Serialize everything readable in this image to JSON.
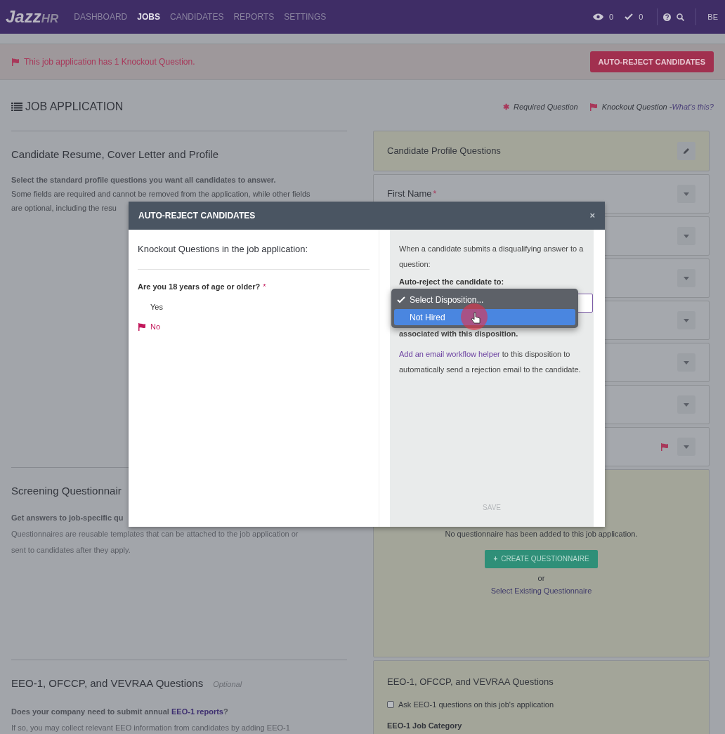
{
  "nav": {
    "logo": [
      "Jazz",
      "HR"
    ],
    "menu": [
      {
        "label": "DASHBOARD",
        "selected": false
      },
      {
        "label": "JOBS",
        "selected": true
      },
      {
        "label": "CANDIDATES",
        "selected": false
      },
      {
        "label": "REPORTS",
        "selected": false
      },
      {
        "label": "SETTINGS",
        "selected": false
      }
    ],
    "views_count": "0",
    "checks_count": "0",
    "user": "BE"
  },
  "banner": {
    "message": "This job application has 1 Knockout Question.",
    "button": "AUTO-REJECT CANDIDATES"
  },
  "header": {
    "title": "JOB APPLICATION",
    "required_icon": "✱",
    "required_legend": "Required Question",
    "knockout_legend": "Knockout Question",
    "separator": " - ",
    "help_link": "What's this?"
  },
  "left_sections": [
    {
      "title": "Candidate Resume, Cover Letter and Profile",
      "lead": "Select the standard profile questions you want all candidates to answer.",
      "lines": [
        "Some fields are required and cannot be removed from the application, while other fields",
        "are optional, including the resu"
      ]
    },
    {
      "title": "Screening Questionnair",
      "lead": "Get answers to job-specific qu",
      "lines": [
        "Questionnaires are reusable templates that can be attached to the job application or",
        "sent to candidates after they apply."
      ]
    },
    {
      "title": "EEO-1, OFCCP, and VEVRAA Questions",
      "tag": "Optional",
      "question_prefix": "Does your company need to submit annual ",
      "question_link": "EEO-1 reports",
      "question_suffix": "?",
      "lines": [
        "If so, you may collect relevant EEO information from candidates by adding EEO-1"
      ]
    }
  ],
  "profile_card": {
    "title": "Candidate Profile Questions",
    "required_mark": "*",
    "rows": [
      {
        "label": "First Name",
        "required": true,
        "knockout": false
      },
      {
        "knockout": false
      },
      {
        "knockout": false
      },
      {
        "knockout": false
      },
      {
        "knockout": false
      },
      {
        "knockout": false
      },
      {
        "knockout": true
      }
    ]
  },
  "screening_card": {
    "message": "No questionnaire has been added to this job application.",
    "button": "CREATE QUESTIONNAIRE",
    "button_icon": "+",
    "or": "or",
    "link": "Select Existing Questionnaire"
  },
  "eeo_card": {
    "title": "EEO-1, OFCCP, and VEVRAA Questions",
    "checkbox": {
      "label": "Ask EEO-1 questions on this job's application",
      "checked": false
    },
    "field_label": "EEO-1 Job Category"
  },
  "modal": {
    "title": "AUTO-REJECT CANDIDATES",
    "close": "×",
    "required_mark": "*",
    "heading": "Knockout Questions in the job application:",
    "question": {
      "text": "Are you 18 years of age or older?",
      "required": true,
      "answers": [
        {
          "label": "Yes",
          "knockout": false
        },
        {
          "label": "No",
          "knockout": true
        }
      ]
    },
    "intro": "When a candidate submits a disqualifying answer to a question:",
    "field_label": "Auto-reject the candidate to:",
    "options": [
      {
        "label": "Select Disposition...",
        "checked": true,
        "highlighted": false
      },
      {
        "label": "Not Hired",
        "checked": false,
        "highlighted": true
      }
    ],
    "note": "associated with this disposition.",
    "link": "Add an email workflow helper",
    "link_rest": " to this disposition to automatically send a rejection email to the candidate.",
    "save": {
      "label": "SAVE",
      "disabled": true
    }
  }
}
